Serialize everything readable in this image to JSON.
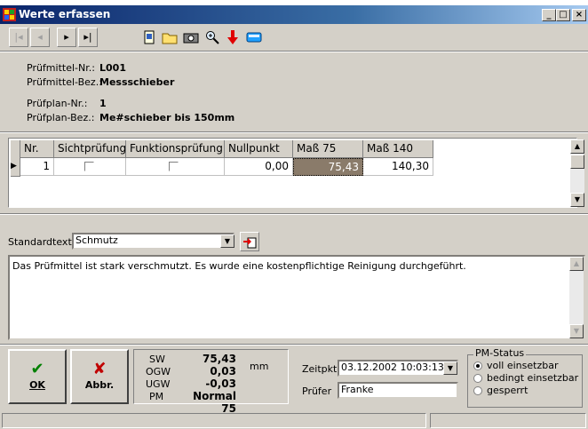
{
  "window": {
    "title": "Werte erfassen",
    "min_label": "_",
    "max_label": "□",
    "close_label": "×"
  },
  "toolbar": {
    "first": "|◂",
    "prev": "◂",
    "next": "▸",
    "last": "▸|",
    "print": "🗋",
    "open": "🗁",
    "camera": "📷",
    "zoom": "🔍",
    "down": "⬇",
    "tag": "▭"
  },
  "info": {
    "pm_nr_label": "Prüfmittel-Nr.:",
    "pm_nr": "L001",
    "pm_bez_label": "Prüfmittel-Bez.:",
    "pm_bez": "Messschieber",
    "pp_nr_label": "Prüfplan-Nr.:",
    "pp_nr": "1",
    "pp_bez_label": "Prüfplan-Bez.:",
    "pp_bez": "Me#schieber bis 150mm"
  },
  "grid": {
    "headers": [
      "Nr.",
      "Sichtprüfung",
      "Funktionsprüfung",
      "Nullpunkt",
      "Maß 75",
      "Maß 140"
    ],
    "row": {
      "nr": "1",
      "sicht": false,
      "funktion": false,
      "nullpunkt": "0,00",
      "mass75": "75,43",
      "mass140": "140,30"
    }
  },
  "standardtext": {
    "label": "Standardtext",
    "value": "Schmutz"
  },
  "memo": "Das Prüfmittel ist stark verschmutzt. Es wurde eine kostenpflichtige Reinigung durchgeführt.",
  "buttons": {
    "ok": "OK",
    "abbr": "Abbr."
  },
  "stats": {
    "sw_label": "SW",
    "sw": "75,43",
    "ogw_label": "OGW",
    "ogw": "0,03",
    "ugw_label": "UGW",
    "ugw": "-0,03",
    "pm_label": "PM",
    "pm": "Normal 75",
    "unit": "mm"
  },
  "zeitpunkt": {
    "label": "Zeitpkt.",
    "value": "03.12.2002 10:03:13"
  },
  "pruefer": {
    "label": "Prüfer",
    "value": "Franke"
  },
  "pm_status": {
    "title": "PM-Status",
    "options": [
      "voll einsetzbar",
      "bedingt einsetzbar",
      "gesperrt"
    ],
    "selected": 0
  }
}
